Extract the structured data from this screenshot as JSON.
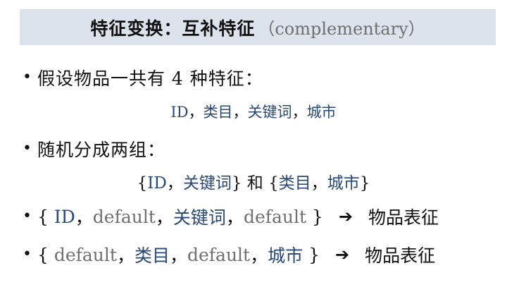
{
  "title": {
    "main": "特征变换：互补特征",
    "sub": "（complementary）"
  },
  "bullet1": {
    "text": "假设物品一共有 4 种特征："
  },
  "features_line": {
    "f1": "ID",
    "s1": "，",
    "f2": "类目",
    "s2": "，",
    "f3": "关键词",
    "s3": "，",
    "f4": "城市"
  },
  "bullet2": {
    "text": "随机分成两组："
  },
  "groups_line": {
    "open1": "{",
    "g1a": "ID",
    "g1sep": "，",
    "g1b": "关键词",
    "close1": "}",
    "and": " 和 ",
    "open2": "{",
    "g2a": "类目",
    "g2sep": "，",
    "g2b": "城市",
    "close2": "}"
  },
  "assign1": {
    "open": "{ ",
    "a": "ID",
    "sep1": "，",
    "b": "default",
    "sep2": "，",
    "c": "关键词",
    "sep3": "，",
    "d": "default",
    "close": " }",
    "arrow": "➔",
    "result": "物品表征"
  },
  "assign2": {
    "open": "{ ",
    "a": "default",
    "sep1": "，",
    "b": "类目",
    "sep2": "，",
    "c": "default",
    "sep3": "，",
    "d": "城市",
    "close": " }",
    "arrow": "➔",
    "result": "物品表征"
  },
  "colors": {
    "feature_blue": "#28487a",
    "default_gray": "#707070",
    "title_bg": "#dde3ec"
  }
}
